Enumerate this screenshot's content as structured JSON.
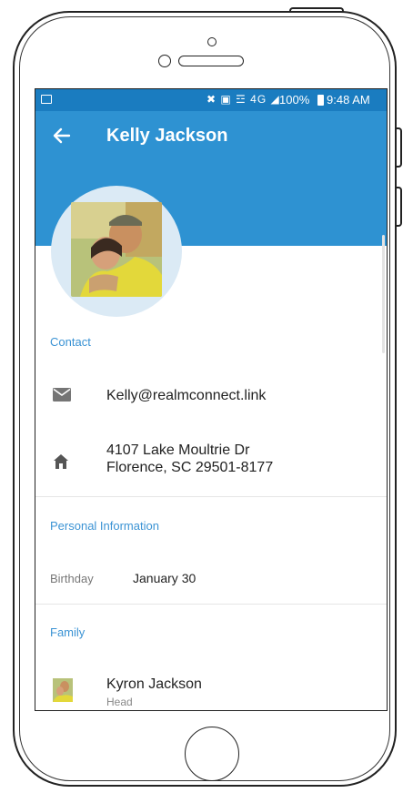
{
  "status_bar": {
    "icons": "✖ ▣ ☲ 4G ◢",
    "battery": "100%",
    "time": "9:48 AM"
  },
  "header": {
    "title": "Kelly Jackson"
  },
  "contact": {
    "section_label": "Contact",
    "email": "Kelly@realmconnect.link",
    "address_line1": "4107 Lake Moultrie Dr",
    "address_line2": "Florence, SC 29501-8177"
  },
  "personal": {
    "section_label": "Personal Information",
    "birthday_label": "Birthday",
    "birthday_value": "January 30"
  },
  "family": {
    "section_label": "Family",
    "members": [
      {
        "name": "Kyron Jackson",
        "role": "Head"
      }
    ]
  },
  "colors": {
    "status_bar": "#1a7cc0",
    "app_bar": "#2e92d2",
    "section_label": "#3b93d4"
  }
}
